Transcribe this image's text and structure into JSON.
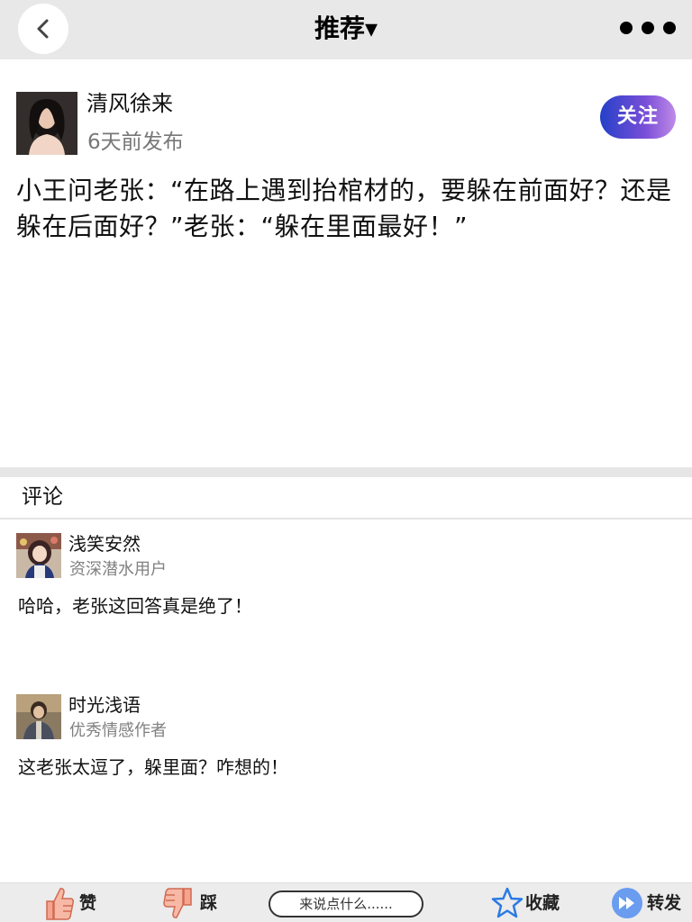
{
  "header": {
    "title": "推荐▾",
    "back_icon": "chevron-left-icon",
    "more_icon": "more-dots-icon"
  },
  "author": {
    "name": "清风徐来",
    "time": "6天前发布",
    "follow_label": "关注"
  },
  "post": {
    "text": "小王问老张：“在路上遇到抬棺材的，要躲在前面好？还是躲在后面好？”老张：“躲在里面最好！”"
  },
  "comments_section": {
    "title": "评论",
    "items": [
      {
        "name": "浅笑安然",
        "role": "资深潜水用户",
        "text": "哈哈，老张这回答真是绝了！"
      },
      {
        "name": "时光浅语",
        "role": "优秀情感作者",
        "text": "这老张太逗了，躲里面？咋想的！"
      }
    ]
  },
  "bottom_bar": {
    "like_label": "赞",
    "dislike_label": "踩",
    "comment_placeholder": "来说点什么......",
    "favorite_label": "收藏",
    "share_label": "转发"
  },
  "colors": {
    "follow_gradient_start": "#2540c8",
    "follow_gradient_end": "#c08ae6",
    "like_icon": "#f4a48f",
    "star_icon": "#2a7be4",
    "share_icon": "#6a9cf0"
  }
}
